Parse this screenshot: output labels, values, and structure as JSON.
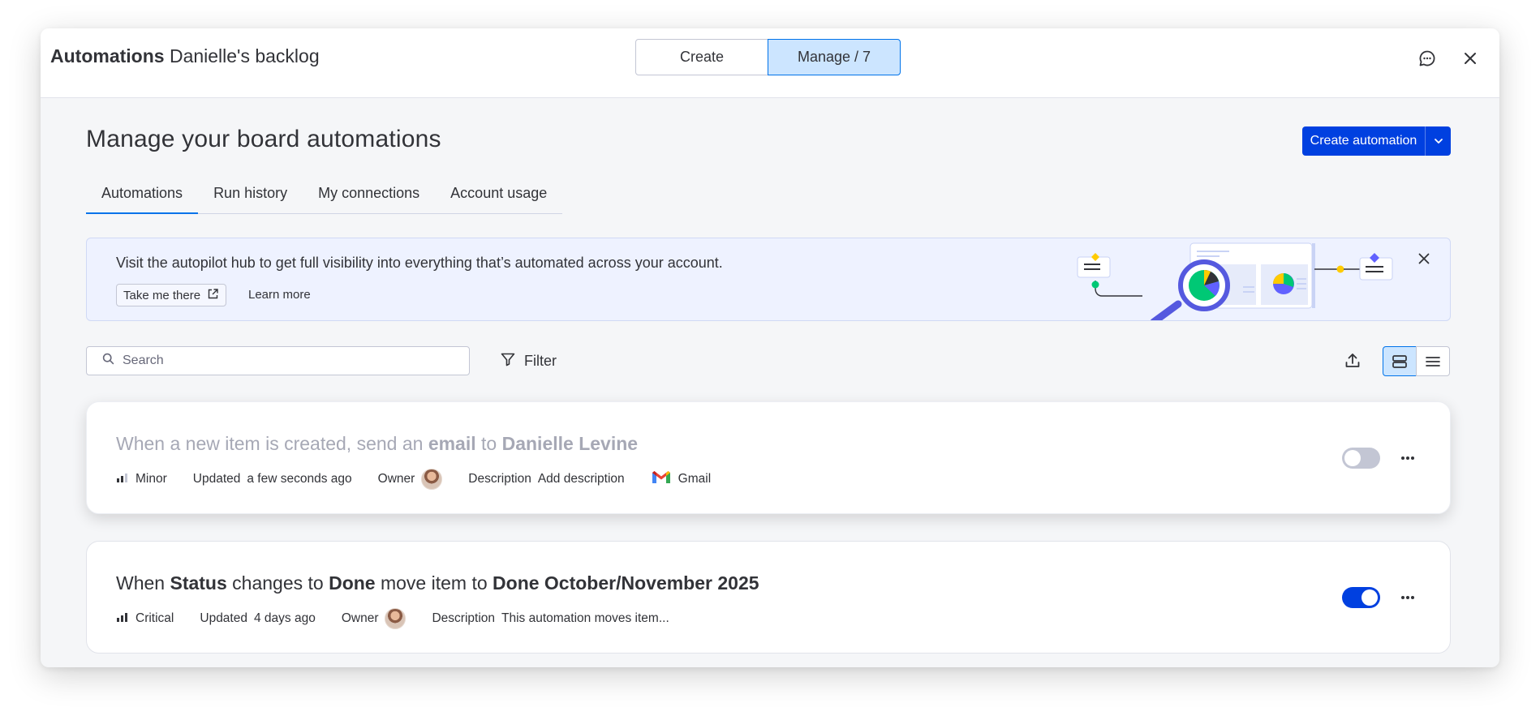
{
  "header": {
    "title_bold": "Automations",
    "title_rest": "Danielle's backlog",
    "segments": [
      "Create",
      "Manage / 7"
    ],
    "feedback_icon": "chat-bubble-icon",
    "close_icon": "close-icon"
  },
  "page": {
    "title": "Manage your board automations",
    "create_button": "Create automation"
  },
  "tabs": [
    "Automations",
    "Run history",
    "My connections",
    "Account usage"
  ],
  "banner": {
    "text": "Visit the autopilot hub to get full visibility into everything that’s automated across your account.",
    "primary_link": "Take me there",
    "secondary_link": "Learn more"
  },
  "toolbar": {
    "search_placeholder": "Search",
    "filter_label": "Filter"
  },
  "automations": [
    {
      "rule_parts": [
        {
          "t": "When a new item is created, send an ",
          "b": false
        },
        {
          "t": "email",
          "b": true
        },
        {
          "t": " to ",
          "b": false
        },
        {
          "t": "Danielle Levine",
          "b": true
        }
      ],
      "priority": "Minor",
      "updated_label": "Updated",
      "updated_value": "a few seconds ago",
      "owner_label": "Owner",
      "description_label": "Description",
      "description_value": "Add description",
      "integration": "Gmail",
      "enabled": false
    },
    {
      "rule_parts": [
        {
          "t": "When ",
          "b": false
        },
        {
          "t": "Status",
          "b": true
        },
        {
          "t": " changes to ",
          "b": false
        },
        {
          "t": "Done",
          "b": true
        },
        {
          "t": " move item to ",
          "b": false
        },
        {
          "t": "Done October/November 2025",
          "b": true
        }
      ],
      "priority": "Critical",
      "updated_label": "Updated",
      "updated_value": "4 days ago",
      "owner_label": "Owner",
      "description_label": "Description",
      "description_value": "This automation moves item...",
      "enabled": true
    }
  ],
  "colors": {
    "accent": "#0040e0",
    "selected_bg": "#cce5ff",
    "banner_bg": "#eef2ff"
  }
}
